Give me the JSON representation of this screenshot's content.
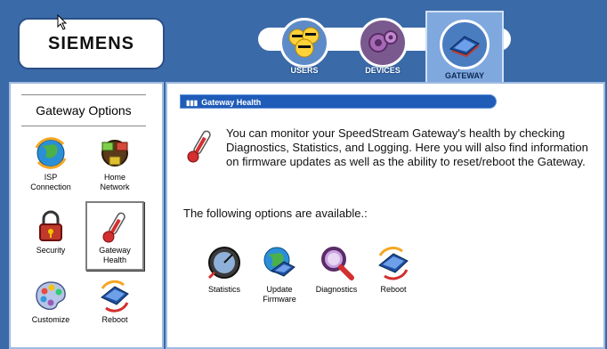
{
  "brand": {
    "logo": "SIEMENS"
  },
  "tabs": [
    {
      "label": "USERS",
      "icon": "users-icon",
      "active": false
    },
    {
      "label": "DEVICES",
      "icon": "devices-icon",
      "active": false
    },
    {
      "label": "GATEWAY",
      "icon": "gateway-icon",
      "active": true
    }
  ],
  "sidebar": {
    "title": "Gateway Options",
    "items": [
      {
        "label_1": "ISP",
        "label_2": "Connection",
        "icon": "globe-icon"
      },
      {
        "label_1": "Home",
        "label_2": "Network",
        "icon": "network-icon"
      },
      {
        "label_1": "Security",
        "label_2": "",
        "icon": "lock-icon"
      },
      {
        "label_1": "Gateway",
        "label_2": "Health",
        "icon": "thermometer-icon",
        "selected": true
      },
      {
        "label_1": "Customize",
        "label_2": "",
        "icon": "palette-icon"
      },
      {
        "label_1": "Reboot",
        "label_2": "",
        "icon": "reboot-icon"
      }
    ]
  },
  "main": {
    "section_title": "Gateway Health",
    "intro": "You can monitor your SpeedStream Gateway's health by checking Diagnostics, Statistics, and Logging. Here you will also find information on firmware updates as well as the ability to reset/reboot the Gateway.",
    "available": "The following options are available.:",
    "actions": [
      {
        "label_1": "Statistics",
        "label_2": "",
        "icon": "statistics-icon"
      },
      {
        "label_1": "Update",
        "label_2": "Firmware",
        "icon": "update-firmware-icon"
      },
      {
        "label_1": "Diagnostics",
        "label_2": "",
        "icon": "magnifier-icon"
      },
      {
        "label_1": "Reboot",
        "label_2": "",
        "icon": "reboot-icon"
      }
    ]
  },
  "colors": {
    "header_bg": "#3b6aa8",
    "section_bar": "#1f5cb8",
    "panel_border": "#9fbbe0"
  }
}
